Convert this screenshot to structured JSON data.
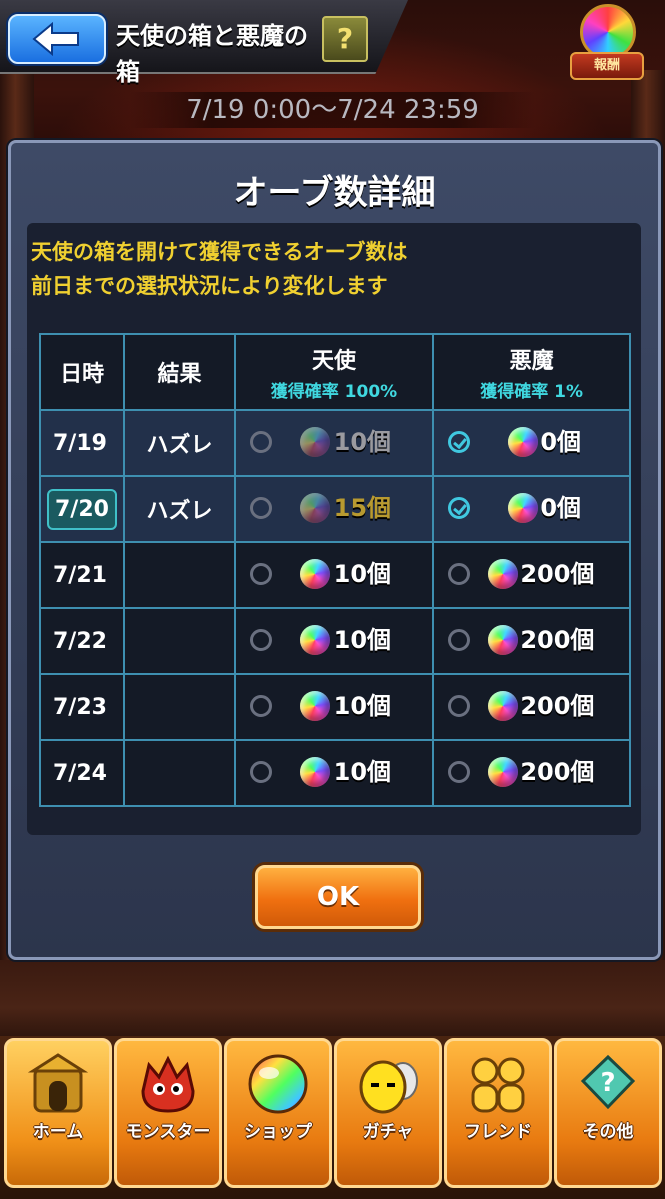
{
  "header": {
    "title": "天使の箱と悪魔の箱",
    "help_label": "?",
    "reward_label": "報酬"
  },
  "period": "7/19 0:00〜7/24 23:59",
  "modal": {
    "title": "オーブ数詳細",
    "notice_lines": [
      "天使の箱を開けて獲得できるオーブ数は",
      "前日までの選択状況により変化します"
    ],
    "columns": {
      "date": "日時",
      "result": "結果",
      "angel": "天使",
      "angel_rate": "獲得確率 100%",
      "devil": "悪魔",
      "devil_rate": "獲得確率 1%"
    },
    "rows": [
      {
        "date": "7/19",
        "result": "ハズレ",
        "angel": "10個",
        "devil": "0個"
      },
      {
        "date": "7/20",
        "result": "ハズレ",
        "angel": "15個",
        "devil": "0個"
      },
      {
        "date": "7/21",
        "result": "",
        "angel": "10個",
        "devil": "200個"
      },
      {
        "date": "7/22",
        "result": "",
        "angel": "10個",
        "devil": "200個"
      },
      {
        "date": "7/23",
        "result": "",
        "angel": "10個",
        "devil": "200個"
      },
      {
        "date": "7/24",
        "result": "",
        "angel": "10個",
        "devil": "200個"
      }
    ],
    "ok_label": "OK"
  },
  "nav": {
    "items": [
      {
        "label": "ホーム",
        "icon": "castle-icon"
      },
      {
        "label": "モンスター",
        "icon": "monster-icon"
      },
      {
        "label": "ショップ",
        "icon": "orb-icon"
      },
      {
        "label": "ガチャ",
        "icon": "egg-icon"
      },
      {
        "label": "フレンド",
        "icon": "friends-icon"
      },
      {
        "label": "その他",
        "icon": "other-icon"
      }
    ]
  },
  "colors": {
    "accent_orange": "#f07010",
    "notice_yellow": "#f0d030",
    "table_border": "#3e8fb0",
    "rate_cyan": "#40d8e0"
  }
}
